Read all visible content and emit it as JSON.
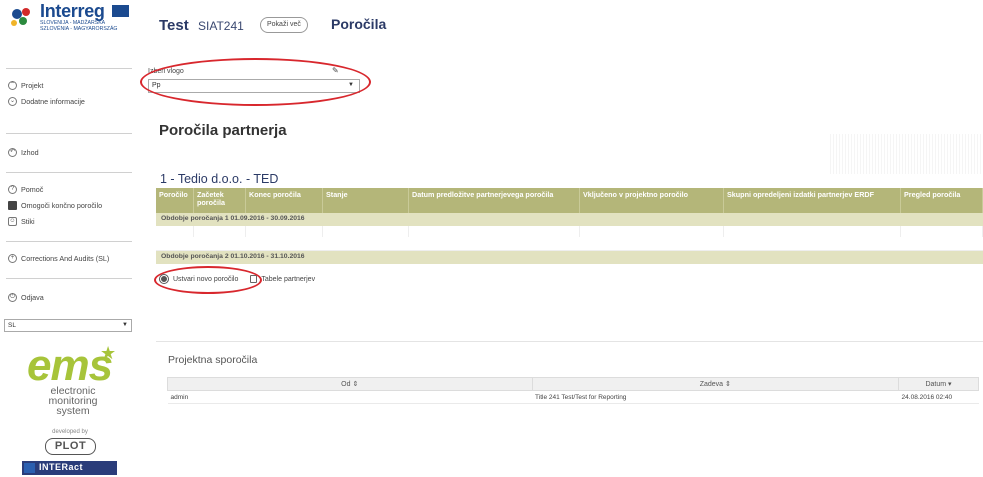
{
  "sidebar": {
    "logo": {
      "name": "Interreg",
      "subtitle": "SLOVENIJA - MADŽARSKA SZLOVÉNIA - MAGYARORSZÁG"
    },
    "groups": [
      [
        {
          "label": "Projekt",
          "icon": "circle-up-icon"
        },
        {
          "label": "Dodatne informacije",
          "icon": "circle-down-icon"
        }
      ],
      [
        {
          "label": "Izhod",
          "icon": "exit-icon"
        }
      ],
      [
        {
          "label": "Pomoč",
          "icon": "help-icon"
        },
        {
          "label": "Omogoči končno poročilo",
          "icon": "square-icon"
        },
        {
          "label": "Stiki",
          "icon": "contacts-icon"
        }
      ],
      [
        {
          "label": "Corrections And Audits (SL)",
          "icon": "plus-icon"
        }
      ],
      [
        {
          "label": "Odjava",
          "icon": "logout-icon"
        }
      ]
    ],
    "language": "SL",
    "ems": {
      "title": "ems",
      "subtitle": "electronic monitoring system",
      "developed_by": "developed by",
      "plot": "PLOT",
      "interact": "INTERact"
    }
  },
  "header": {
    "title": "Test",
    "code": "SIAT241",
    "more_button": "Pokaži več",
    "reports_link": "Poročila"
  },
  "role": {
    "label": "Izberi vlogo",
    "value": "Pp"
  },
  "page_title": "Poročila partnerja",
  "partner_title": "1 - Tedio d.o.o. - TED",
  "report_table": {
    "columns": [
      "Poročilo",
      "Začetek poročila",
      "Konec poročila",
      "Stanje",
      "Datum predložitve partnerjevega poročila",
      "Vključeno v projektno poročilo",
      "Skupni opredeljeni izdatki partnerjev ERDF",
      "Pregled poročila"
    ],
    "periods": [
      "Obdobje poročanja 1 01.09.2016 - 30.09.2016",
      "Obdobje poročanja 2 01.10.2016 - 31.10.2016"
    ]
  },
  "actions": {
    "new_report": "Ustvari novo poročilo",
    "partner_tables": "Tabele partnerjev"
  },
  "messages": {
    "title": "Projektna sporočila",
    "columns": [
      "Od ⇕",
      "Zadeva ⇕",
      "Datum ▾"
    ],
    "rows": [
      [
        "admin",
        "Title 241 Test/Test for Reporting",
        "24.08.2016 02:40"
      ]
    ]
  },
  "colors": {
    "table_header": "#b4b679",
    "period_row": "#e2e2c0",
    "highlight": "#d8272d",
    "brand": "#2b3a66"
  }
}
